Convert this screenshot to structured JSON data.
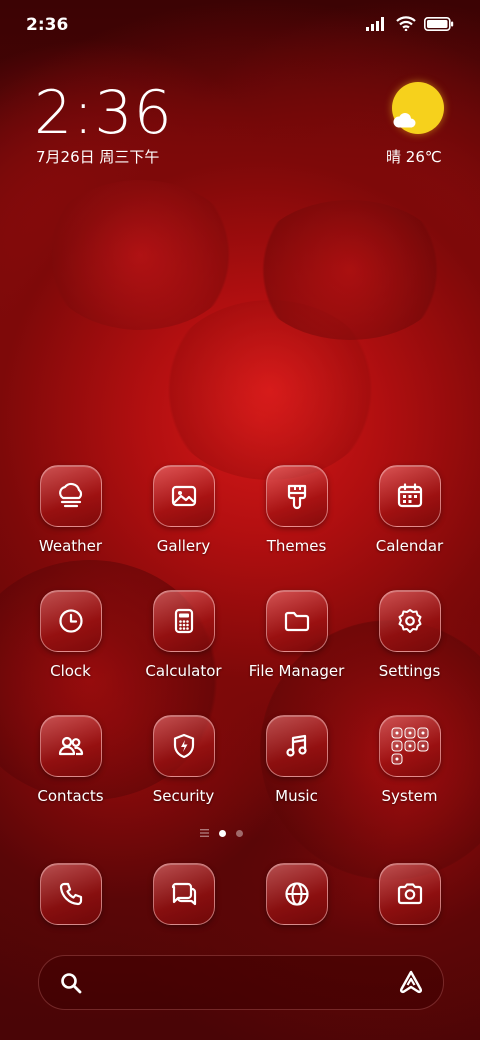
{
  "status_bar": {
    "time": "2:36",
    "icons": [
      "signal-icon",
      "wifi-icon",
      "battery-icon"
    ]
  },
  "clock_widget": {
    "time": "2:36",
    "date": "7月26日 周三下午"
  },
  "weather_widget": {
    "condition": "晴",
    "temperature": "26℃",
    "icon": "sunny-partly-cloudy-icon"
  },
  "apps": [
    {
      "label": "Weather",
      "icon": "weather-icon"
    },
    {
      "label": "Gallery",
      "icon": "gallery-icon"
    },
    {
      "label": "Themes",
      "icon": "themes-brush-icon"
    },
    {
      "label": "Calendar",
      "icon": "calendar-icon"
    },
    {
      "label": "Clock",
      "icon": "clock-icon"
    },
    {
      "label": "Calculator",
      "icon": "calculator-icon"
    },
    {
      "label": "File Manager",
      "icon": "folder-icon"
    },
    {
      "label": "Settings",
      "icon": "gear-icon"
    },
    {
      "label": "Contacts",
      "icon": "contacts-icon"
    },
    {
      "label": "Security",
      "icon": "shield-icon"
    },
    {
      "label": "Music",
      "icon": "music-note-icon"
    },
    {
      "label": "System",
      "icon": "system-folder-icon"
    }
  ],
  "page_indicator": {
    "pages": 2,
    "current": 1
  },
  "dock": [
    {
      "icon": "phone-icon"
    },
    {
      "icon": "messages-icon"
    },
    {
      "icon": "browser-globe-icon"
    },
    {
      "icon": "camera-icon"
    }
  ],
  "search_bar": {
    "left_icon": "search-icon",
    "right_icon": "assistant-icon"
  },
  "colors": {
    "accent": "#f6d11c",
    "tile_border": "#ffc8c8",
    "background": "#7e0909"
  }
}
